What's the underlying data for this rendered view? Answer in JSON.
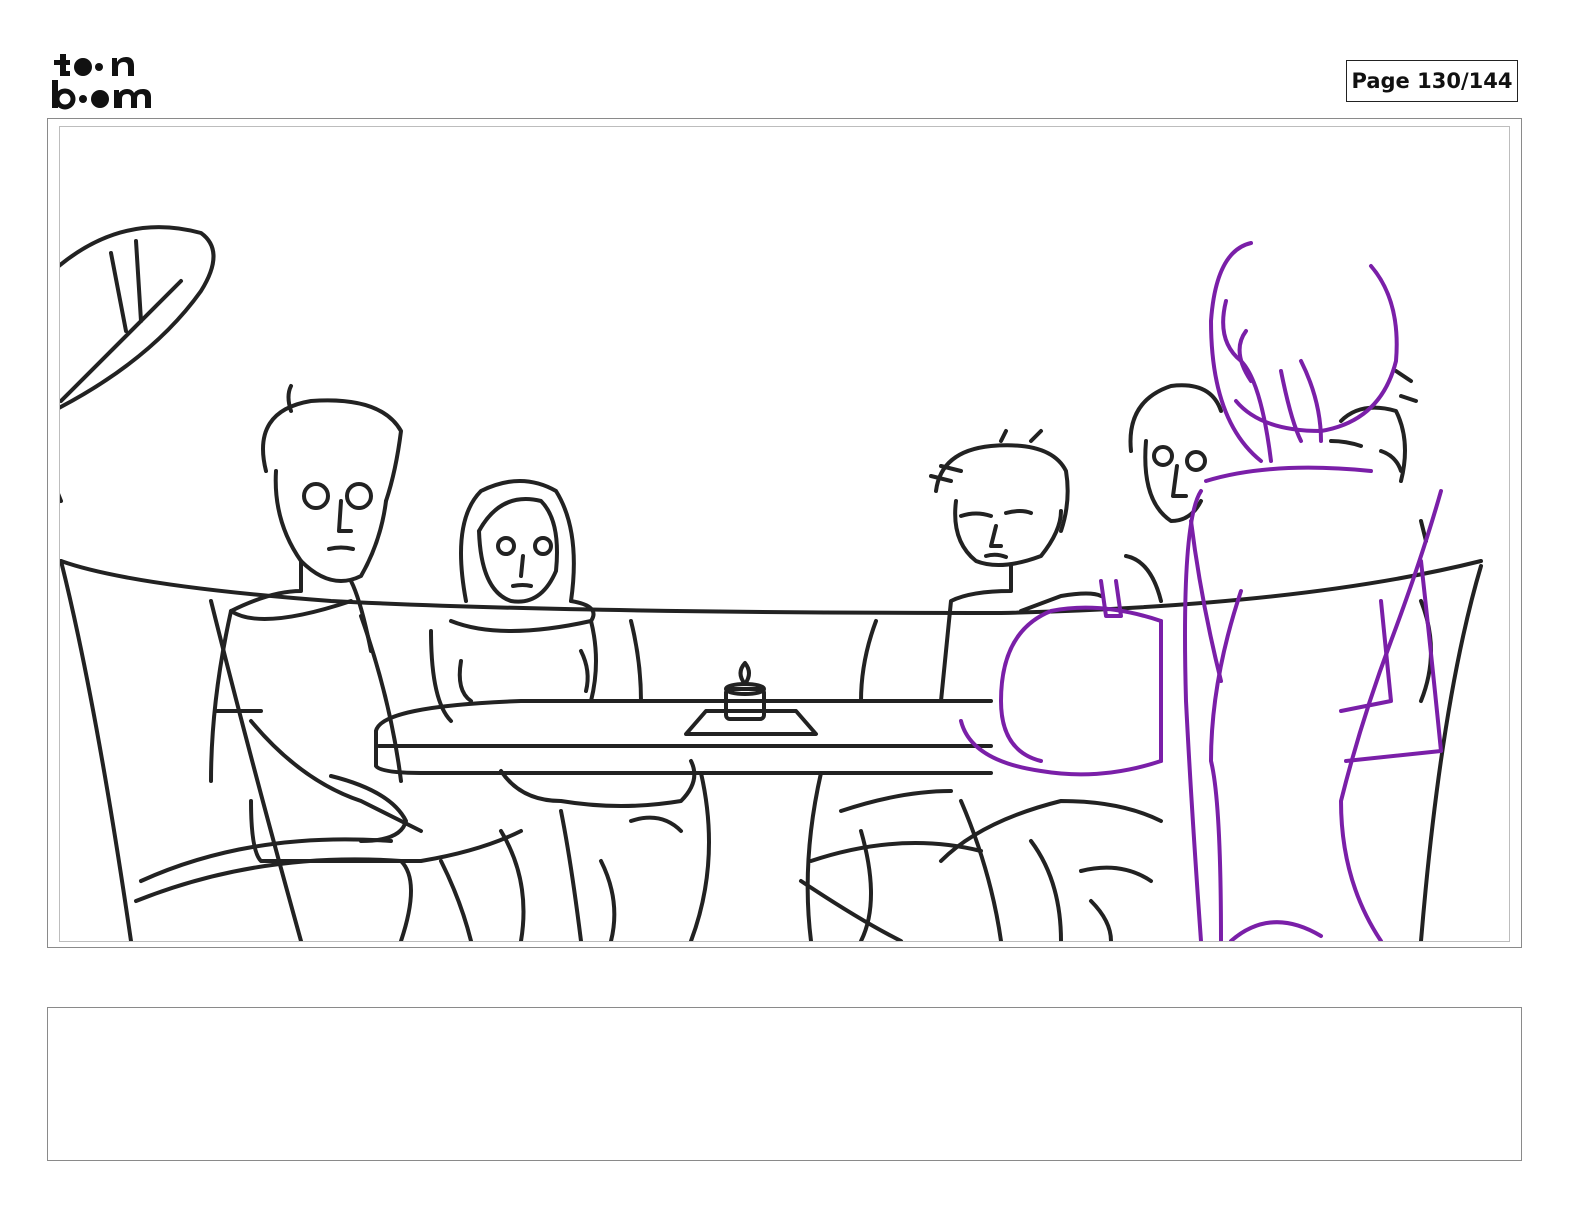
{
  "header": {
    "logo_text_top": "toon",
    "logo_text_bottom": "boom",
    "page_label": "Page 130/144"
  },
  "panel": {
    "pencil_color": "#222222",
    "rough_color": "#7a1fa8"
  },
  "notes": {
    "text": ""
  }
}
